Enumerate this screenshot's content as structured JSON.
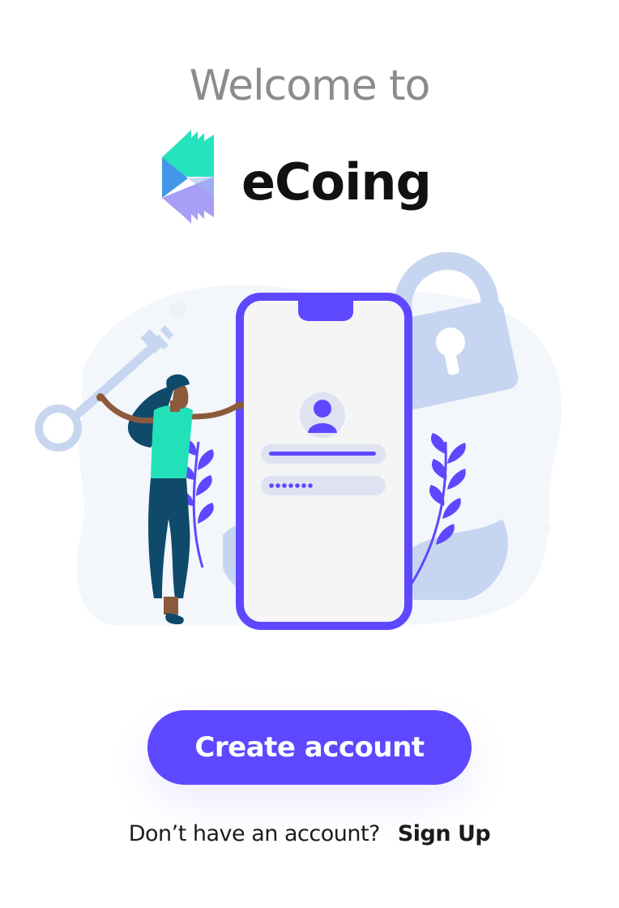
{
  "header": {
    "welcome_text": "Welcome to",
    "brand_name": "eCoing",
    "logo_icon": "ecoing-logo-icon"
  },
  "illustration": {
    "icon": "login-illustration-icon",
    "colors": {
      "accent": "#5d48ff",
      "soft_blue": "#c7d6f0",
      "background_blob": "#f3f6fb",
      "teal": "#22e0b8",
      "navy": "#0f4a6b"
    }
  },
  "actions": {
    "create_account_label": "Create account",
    "signup_prompt": "Don’t have an account?",
    "signup_link": "Sign Up"
  },
  "colors": {
    "primary_button": "#5d48ff",
    "welcome_text": "#8c8c8c",
    "brand_text": "#111111"
  }
}
